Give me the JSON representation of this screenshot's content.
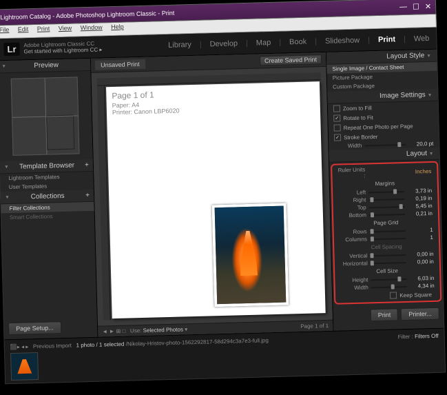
{
  "titlebar": "Lightroom Catalog - Adobe Photoshop Lightroom Classic - Print",
  "menus": [
    "File",
    "Edit",
    "Print",
    "View",
    "Window",
    "Help"
  ],
  "tagline1": "Adobe Lightroom Classic CC",
  "tagline2": "Get started with Lightroom CC ▸",
  "modules": [
    "Library",
    "Develop",
    "Map",
    "Book",
    "Slideshow",
    "Print",
    "Web"
  ],
  "active_module": "Print",
  "left": {
    "preview": "Preview",
    "template_browser": "Template Browser",
    "templates": [
      "Lightroom Templates",
      "User Templates"
    ],
    "collections": "Collections",
    "filter_collections": "Filter Collections",
    "smart": "Smart Collections",
    "page_setup": "Page Setup..."
  },
  "center": {
    "unsaved": "Unsaved Print",
    "create_saved": "Create Saved Print",
    "page_title": "Page 1 of 1",
    "paper": "Paper: A4",
    "printer": "Printer: Canon LBP6020",
    "use": "Use:",
    "selected_photos": "Selected Photos",
    "page_info": "Page 1 of 1"
  },
  "right": {
    "layout_style": "Layout Style",
    "styles": [
      "Single Image / Contact Sheet",
      "Picture Package",
      "Custom Package"
    ],
    "image_settings": "Image Settings",
    "zoom_to_fill": "Zoom to Fill",
    "rotate_to_fit": "Rotate to Fit",
    "repeat": "Repeat One Photo per Page",
    "stroke_border": "Stroke Border",
    "width": "Width",
    "width_val": "20,0 pt",
    "layout": "Layout",
    "ruler_units": "Ruler Units :",
    "ruler_val": "Inches",
    "margins": "Margins",
    "m_left": "Left",
    "m_left_v": "3,73 in",
    "m_right": "Right",
    "m_right_v": "0,19 in",
    "m_top": "Top",
    "m_top_v": "5,45 in",
    "m_bottom": "Bottom",
    "m_bottom_v": "0,21 in",
    "page_grid": "Page Grid",
    "rows": "Rows",
    "rows_v": "1",
    "cols": "Columns",
    "cols_v": "1",
    "cell_spacing": "Cell Spacing",
    "vertical": "Vertical",
    "vertical_v": "0,00 in",
    "horizontal": "Horizontal",
    "horizontal_v": "0,00 in",
    "cell_size": "Cell Size",
    "height": "Height",
    "height_v": "6,03 in",
    "cwidth": "Width",
    "cwidth_v": "4,34 in",
    "keep_square": "Keep Square",
    "print_btn": "Print",
    "printer_btn": "Printer..."
  },
  "filmstrip": {
    "prev_import": "Previous Import",
    "count": "1 photo / 1 selected",
    "path": "/Nikolay-Hristov-photo-1562292817-58d294c3a7e3-full.jpg",
    "filter": "Filter :",
    "filters_off": "Filters Off"
  }
}
